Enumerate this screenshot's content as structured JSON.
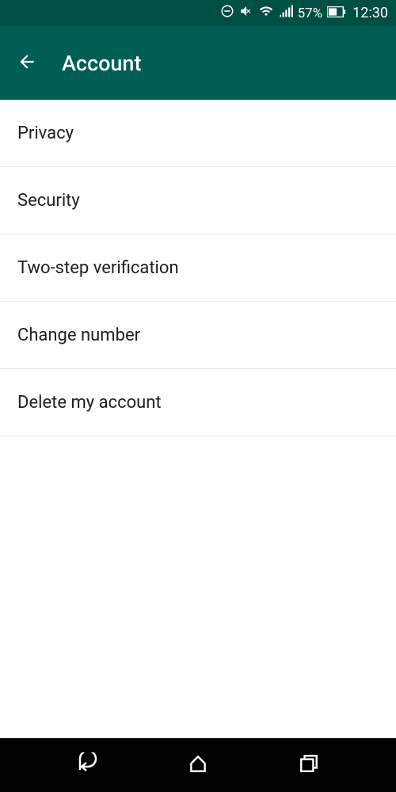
{
  "status": {
    "battery_percent": "57%",
    "time": "12:30"
  },
  "header": {
    "title": "Account"
  },
  "menu": {
    "items": [
      {
        "label": "Privacy"
      },
      {
        "label": "Security"
      },
      {
        "label": "Two-step verification"
      },
      {
        "label": "Change number"
      },
      {
        "label": "Delete my account"
      }
    ]
  }
}
